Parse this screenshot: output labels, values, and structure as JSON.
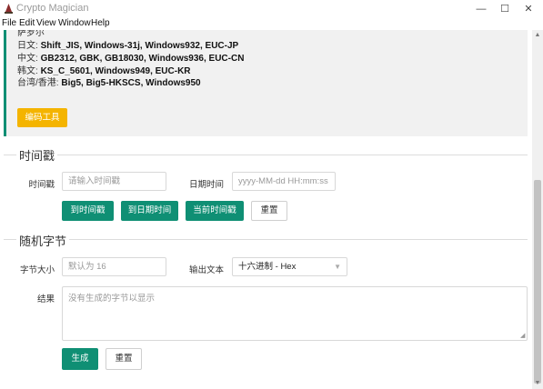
{
  "window": {
    "title": "Crypto Magician",
    "minimize_glyph": "—",
    "maximize_glyph": "☐",
    "close_glyph": "✕"
  },
  "menu": [
    "File",
    "Edit",
    "View",
    "Window",
    "Help"
  ],
  "info_panel": {
    "cut_line": "萨罗尔",
    "lines": [
      {
        "label": "日文: ",
        "value": "Shift_JIS, Windows-31j, Windows932, EUC-JP"
      },
      {
        "label": "中文: ",
        "value": "GB2312, GBK, GB18030, Windows936, EUC-CN"
      },
      {
        "label": "韩文: ",
        "value": "KS_C_5601, Windows949, EUC-KR"
      },
      {
        "label": "台湾/香港: ",
        "value": "Big5, Big5-HKSCS, Windows950"
      }
    ],
    "button_label": "编码工具"
  },
  "timestamp": {
    "section_title": "时间戳",
    "ts_label": "时间戳",
    "ts_placeholder": "请输入时间戳",
    "date_label": "日期时间",
    "date_placeholder": "yyyy-MM-dd HH:mm:ss",
    "btn_to_timestamp": "到时间戳",
    "btn_to_datetime": "到日期时间",
    "btn_current": "当前时间戳",
    "btn_reset": "重置"
  },
  "random_bytes": {
    "section_title": "随机字节",
    "size_label": "字节大小",
    "size_placeholder": "默认为 16",
    "output_label": "输出文本",
    "output_value": "十六进制 - Hex",
    "result_label": "结果",
    "result_placeholder": "没有生成的字节以显示",
    "btn_generate": "生成",
    "btn_reset": "重置"
  },
  "colors": {
    "accent": "#0f8f74",
    "warning": "#f4b400",
    "panel_bg": "#f1f1f1"
  }
}
